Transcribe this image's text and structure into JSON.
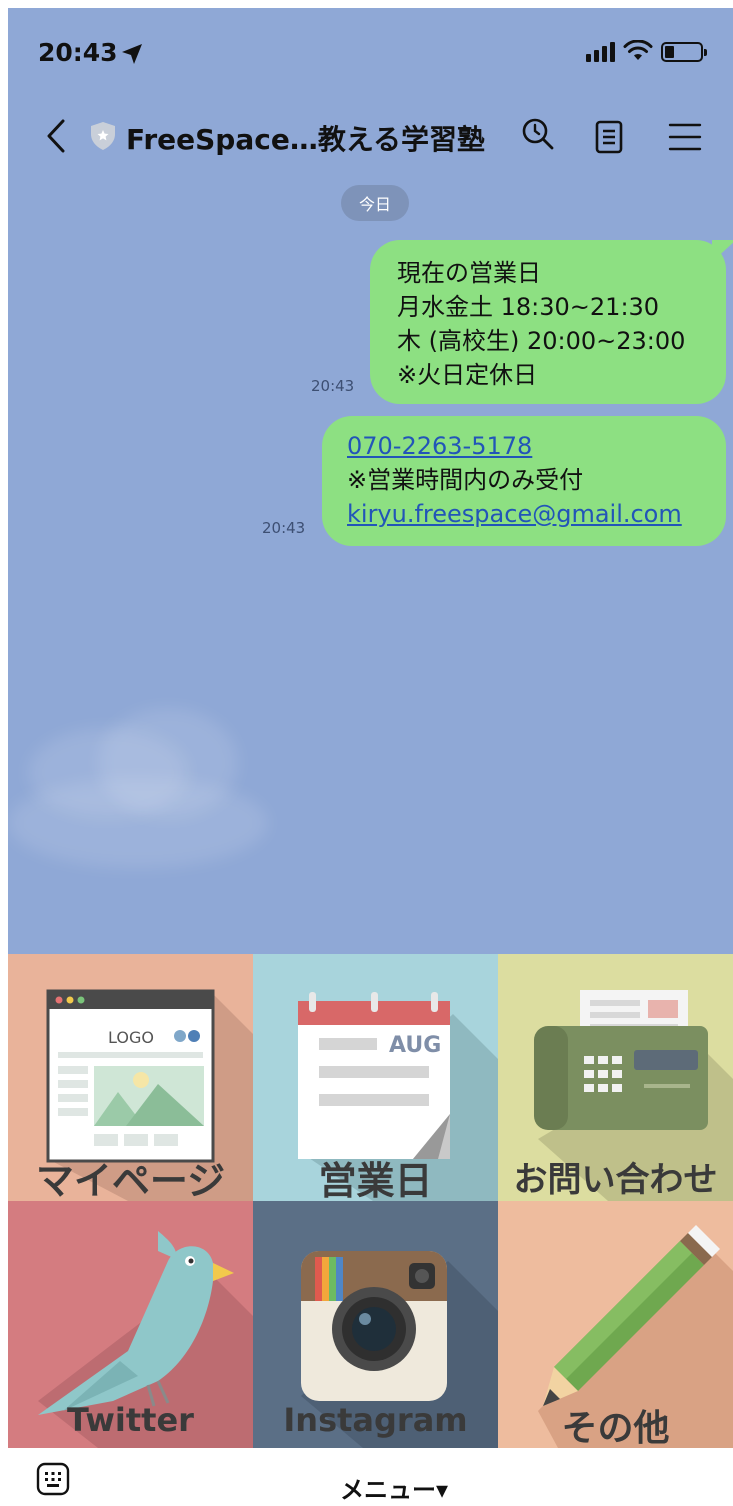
{
  "status_bar": {
    "time": "20:43",
    "icons": [
      "location-arrow-icon",
      "signal-bars-icon",
      "wifi-icon",
      "battery-icon"
    ]
  },
  "header": {
    "title": "FreeSpace…教える学習塾",
    "icons": [
      "back-chevron-icon",
      "verified-shield-icon",
      "search-icon",
      "notes-icon",
      "menu-icon"
    ]
  },
  "chat": {
    "date_label": "今日",
    "messages": [
      {
        "time": "20:43",
        "lines": [
          "現在の営業日",
          "月水金土 18:30~21:30",
          "木 (高校生) 20:00~23:00",
          "※火日定休日"
        ]
      },
      {
        "time": "20:43",
        "phone": "070-2263-5178",
        "note": "※営業時間内のみ受付",
        "email": "kiryu.freespace@gmail.com"
      }
    ]
  },
  "rich_menu": {
    "tiles": [
      {
        "label": "マイページ",
        "icon": "webpage-icon",
        "color": "#e9b39a"
      },
      {
        "label": "営業日",
        "icon": "calendar-icon",
        "color": "#a8d4dc",
        "icon_text": "AUG"
      },
      {
        "label": "お問い合わせ",
        "icon": "fax-phone-icon",
        "color": "#dcdda0"
      },
      {
        "label": "Twitter",
        "icon": "bird-icon",
        "color": "#d47c80"
      },
      {
        "label": "Instagram",
        "icon": "camera-icon",
        "color": "#5b6f86"
      },
      {
        "label": "その他",
        "icon": "pencil-icon",
        "color": "#eebc9e"
      }
    ],
    "webpage_logo_text": "LOGO"
  },
  "bottom_bar": {
    "menu_label": "メニュー▾",
    "icons": [
      "keyboard-icon"
    ]
  }
}
